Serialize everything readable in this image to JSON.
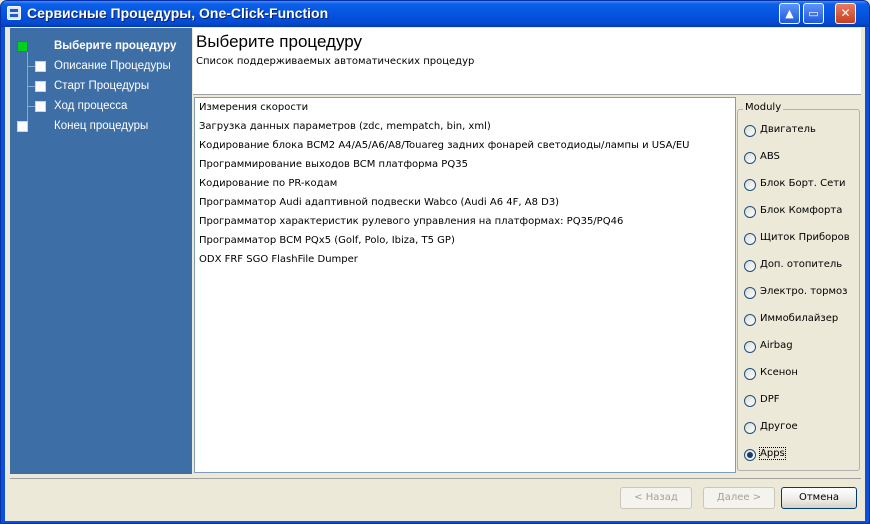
{
  "window": {
    "title": "Сервисные Процедуры, One-Click-Function",
    "controls": {
      "minimize": "▲",
      "maximize": "▭",
      "close": "✕"
    }
  },
  "steps": [
    {
      "label": "Выберите процедуру",
      "active": true
    },
    {
      "label": "Описание Процедуры",
      "active": false
    },
    {
      "label": "Старт Процедуры",
      "active": false
    },
    {
      "label": "Ход процесса",
      "active": false
    },
    {
      "label": "Конец процедуры",
      "active": false
    }
  ],
  "header": {
    "title": "Выберите процедуру",
    "subtitle": "Список поддерживаемых автоматических процедур"
  },
  "procedures": [
    "Измерения скорости",
    "Загрузка данных параметров (zdc, mempatch, bin, xml)",
    "Кодирование блока  BCM2 A4/A5/A6/A8/Touareg  задних фонарей светодиоды/лампы и  USA/EU",
    "Программирование выходов BCM платформа PQ35",
    "Кодирование по PR-кодам",
    "Программатор Audi адаптивной подвески Wabco (Audi A6 4F, A8 D3)",
    "Программатор характеристик рулевого управления на платформах: PQ35/PQ46",
    "Программатор BCM PQx5 (Golf, Polo, Ibiza, T5 GP)",
    "ODX FRF SGO FlashFile Dumper"
  ],
  "moduly": {
    "legend": "Moduly",
    "options": [
      "Двигатель",
      "ABS",
      "Блок Борт. Сети",
      "Блок Комфорта",
      "Щиток Приборов",
      "Доп. отопитель",
      "Электро. тормоз",
      "Иммобилайзер",
      "Airbag",
      "Ксенон",
      "DPF",
      "Другое",
      "Apps"
    ],
    "selected": "Apps"
  },
  "buttons": {
    "back": "< Назад",
    "next": "Далее >",
    "cancel": "Отмена"
  }
}
